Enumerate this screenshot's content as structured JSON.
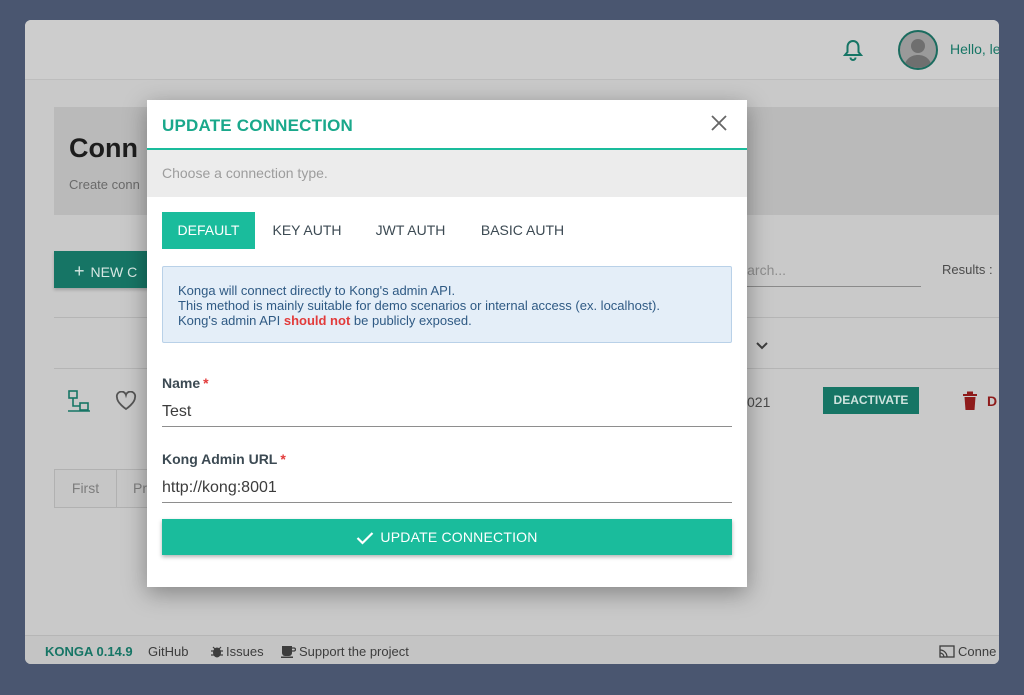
{
  "background": {
    "topbar": {
      "greeting": "Hello, le"
    },
    "header": {
      "title": "Conn",
      "subtitle": "Create conn"
    },
    "new_button_label": "NEW C",
    "search_placeholder": "Search...",
    "results_label": "Results :",
    "row": {
      "date_fragment": "021",
      "deactivate_label": "DEACTIVATE",
      "delete_fragment": "D"
    },
    "pagination": {
      "first": "First",
      "prev": "Pr"
    },
    "footer": {
      "brand": "KONGA 0.14.9",
      "github": "GitHub",
      "issues": "Issues",
      "support": "Support the project",
      "connections": "Conne"
    }
  },
  "modal": {
    "title": "UPDATE CONNECTION",
    "hint": "Choose a connection type.",
    "tabs": [
      {
        "label": "DEFAULT",
        "active": true
      },
      {
        "label": "KEY AUTH",
        "active": false
      },
      {
        "label": "JWT AUTH",
        "active": false
      },
      {
        "label": "BASIC AUTH",
        "active": false
      }
    ],
    "info": {
      "line1": "Konga will connect directly to Kong's admin API.",
      "line2": "This method is mainly suitable for demo scenarios or internal access (ex. localhost).",
      "line3_prefix": "Kong's admin API",
      "line3_warning": "should not",
      "line3_suffix": "be publicly exposed."
    },
    "fields": {
      "name": {
        "label": "Name",
        "required_mark": "*",
        "value": "Test"
      },
      "url": {
        "label": "Kong Admin URL",
        "required_mark": "*",
        "value": "http://kong:8001"
      }
    },
    "submit_label": "UPDATE CONNECTION"
  },
  "colors": {
    "accent": "#1abc9c",
    "accent_dark": "#167565",
    "warning": "#e23b3b"
  }
}
